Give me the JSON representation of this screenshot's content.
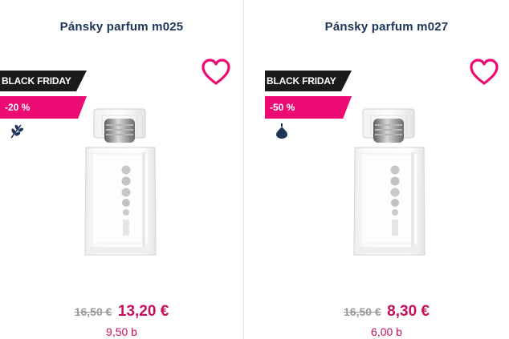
{
  "colors": {
    "title": "#1d3557",
    "accent_pink": "#ec0b72",
    "price": "#c7105d",
    "badge_dark": "#1b1b1b",
    "old_price": "#9a9a9a"
  },
  "products": [
    {
      "title": "Pánsky parfum m025",
      "badge_black_friday": "BLACK FRIDAY",
      "badge_discount": "-20 %",
      "category_icon": "leaf-sprig-icon",
      "old_price": "16,50 €",
      "new_price": "13,20 €",
      "points": "9,50 b"
    },
    {
      "title": "Pánsky parfum m027",
      "badge_black_friday": "BLACK FRIDAY",
      "badge_discount": "-50 %",
      "category_icon": "perfume-drop-icon",
      "old_price": "16,50 €",
      "new_price": "8,30 €",
      "points": "6,00 b"
    }
  ]
}
